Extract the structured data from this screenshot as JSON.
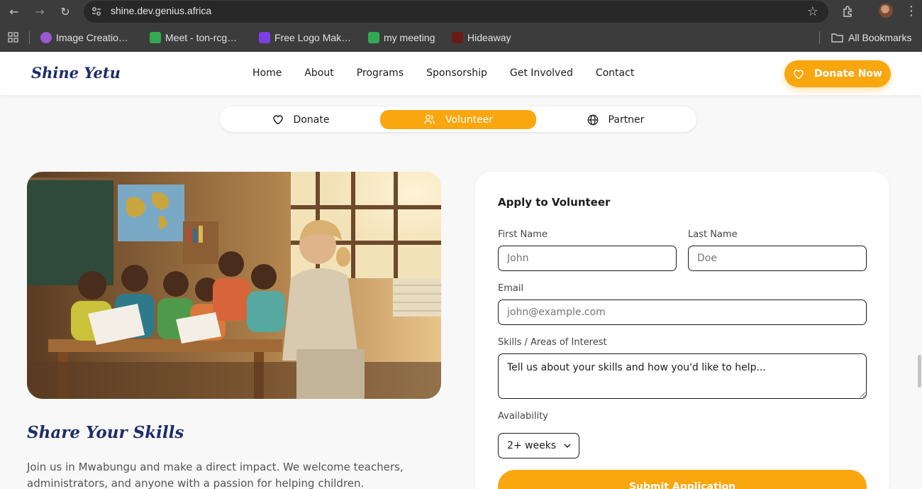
{
  "browser": {
    "url": "shine.dev.genius.africa",
    "bookmarks": [
      {
        "label": "Image Creatio…",
        "icon": "image-creator-favicon",
        "color": "#9b59d0"
      },
      {
        "label": "Meet - ton-rcg…",
        "icon": "google-meet-favicon",
        "color": "#34a853"
      },
      {
        "label": "Free Logo Mak…",
        "icon": "logo-maker-favicon",
        "color": "#7b3fe4"
      },
      {
        "label": "my meeting",
        "icon": "google-meet-favicon",
        "color": "#34a853"
      },
      {
        "label": "Hideaway",
        "icon": "hideaway-favicon",
        "color": "#6b1a1a"
      }
    ],
    "all_bookmarks": "All Bookmarks"
  },
  "site": {
    "logo": "Shine Yetu",
    "nav": [
      "Home",
      "About",
      "Programs",
      "Sponsorship",
      "Get Involved",
      "Contact"
    ],
    "donate_now": "Donate Now",
    "accent_color": "#f9a60f",
    "brand_color": "#1e2c6b"
  },
  "tabs": [
    {
      "label": "Donate",
      "icon": "heart-icon",
      "active": false
    },
    {
      "label": "Volunteer",
      "icon": "users-icon",
      "active": true
    },
    {
      "label": "Partner",
      "icon": "globe-icon",
      "active": false
    }
  ],
  "main": {
    "image_alt": "Volunteer teacher reading with children in a classroom",
    "title": "Share Your Skills",
    "text": "Join us in Mwabungu and make a direct impact. We welcome teachers, administrators, and anyone with a passion for helping children."
  },
  "form": {
    "title": "Apply to Volunteer",
    "first_name_label": "First Name",
    "first_name_placeholder": "John",
    "last_name_label": "Last Name",
    "last_name_placeholder": "Doe",
    "email_label": "Email",
    "email_placeholder": "john@example.com",
    "skills_label": "Skills / Areas of Interest",
    "skills_placeholder": "Tell us about your skills and how you'd like to help...",
    "availability_label": "Availability",
    "availability_value": "2+ weeks",
    "submit": "Submit Application"
  }
}
